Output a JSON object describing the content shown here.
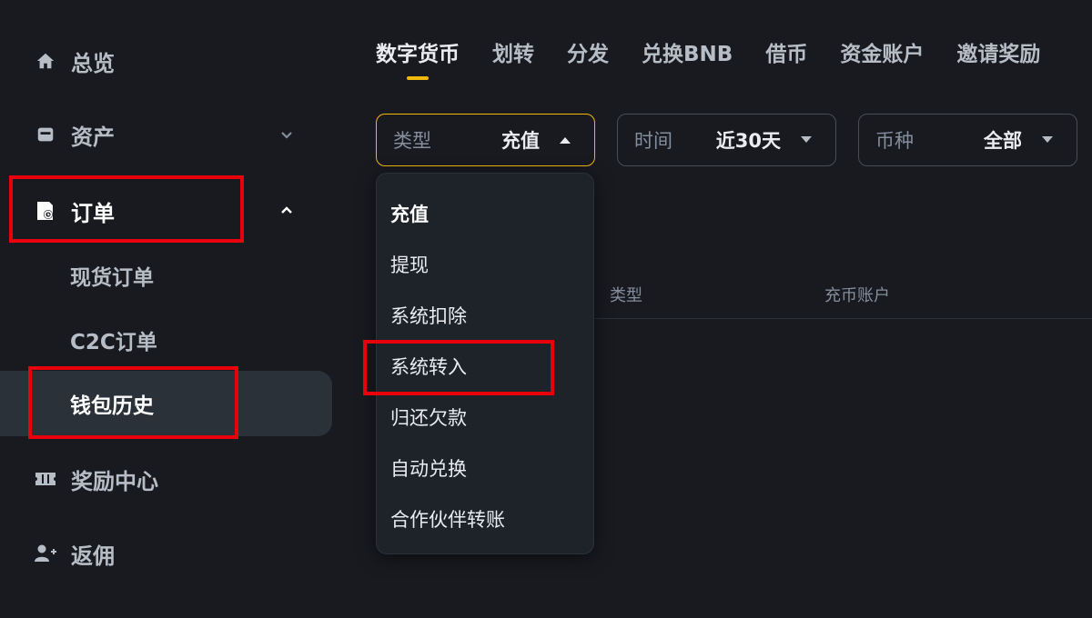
{
  "sidebar": {
    "items": [
      {
        "label": "总览",
        "icon": "home-icon"
      },
      {
        "label": "资产",
        "icon": "wallet-icon",
        "chevron": "chevron-down-icon"
      },
      {
        "label": "订单",
        "icon": "order-icon",
        "chevron": "chevron-up-icon",
        "expanded": true
      },
      {
        "label": "奖励中心",
        "icon": "ticket-icon"
      },
      {
        "label": "返佣",
        "icon": "add-user-icon"
      }
    ],
    "order_sub_items": [
      {
        "label": "现货订单"
      },
      {
        "label": "C2C订单"
      },
      {
        "label": "钱包历史",
        "selected": true
      }
    ]
  },
  "tabs": [
    {
      "label": "数字货币",
      "active": true
    },
    {
      "label": "划转"
    },
    {
      "label": "分发"
    },
    {
      "label": "兑换BNB"
    },
    {
      "label": "借币"
    },
    {
      "label": "资金账户"
    },
    {
      "label": "邀请奖励"
    }
  ],
  "filters": {
    "type": {
      "label": "类型",
      "value": "充值",
      "open": true
    },
    "time": {
      "label": "时间",
      "value": "近30天"
    },
    "coin": {
      "label": "币种",
      "value": "全部"
    }
  },
  "table": {
    "headers": [
      "类型",
      "充币账户"
    ]
  },
  "type_dropdown": {
    "options": [
      "充值",
      "提现",
      "系统扣除",
      "系统转入",
      "归还欠款",
      "自动兑换",
      "合作伙伴转账"
    ],
    "selected": "充值"
  },
  "colors": {
    "background": "#181a20",
    "accent": "#f0b90b",
    "highlight": "#e8000b",
    "panel": "#1e2329"
  }
}
